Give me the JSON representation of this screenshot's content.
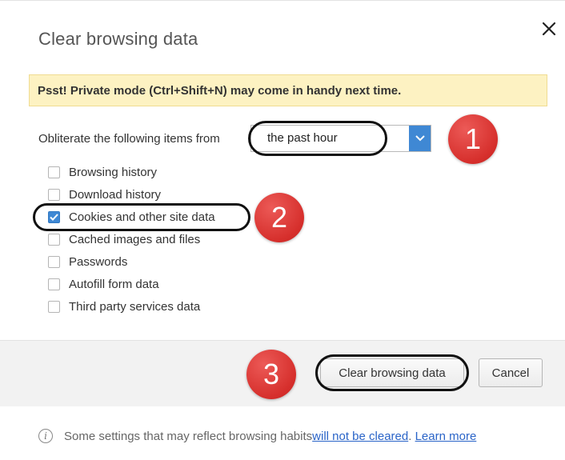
{
  "dialog": {
    "title": "Clear browsing data",
    "close_icon": "close-icon"
  },
  "banner": {
    "text": "Psst! Private mode (Ctrl+Shift+N) may come in handy next time."
  },
  "time_range": {
    "label": "Obliterate the following items from",
    "selected": "the past hour",
    "arrow_icon": "chevron-down-icon"
  },
  "items": [
    {
      "label": "Browsing history",
      "checked": false
    },
    {
      "label": "Download history",
      "checked": false
    },
    {
      "label": "Cookies and other site data",
      "checked": true
    },
    {
      "label": "Cached images and files",
      "checked": false
    },
    {
      "label": "Passwords",
      "checked": false
    },
    {
      "label": "Autofill form data",
      "checked": false
    },
    {
      "label": "Third party services data",
      "checked": false
    }
  ],
  "annotations": {
    "step1": "1",
    "step2": "2",
    "step3": "3",
    "badge_color": "#d62f2c",
    "ring_color": "#111111"
  },
  "buttons": {
    "clear_label": "Clear browsing data",
    "cancel_label": "Cancel"
  },
  "footer": {
    "info_icon": "info-icon",
    "note_prefix": "Some settings that may reflect browsing habits ",
    "link_not_cleared": "will not be cleared",
    "separator": ". ",
    "link_learn_more": "Learn more"
  },
  "colors": {
    "accent": "#3f88d4",
    "banner_bg": "#fdf2c2",
    "link": "#2a64c8"
  }
}
